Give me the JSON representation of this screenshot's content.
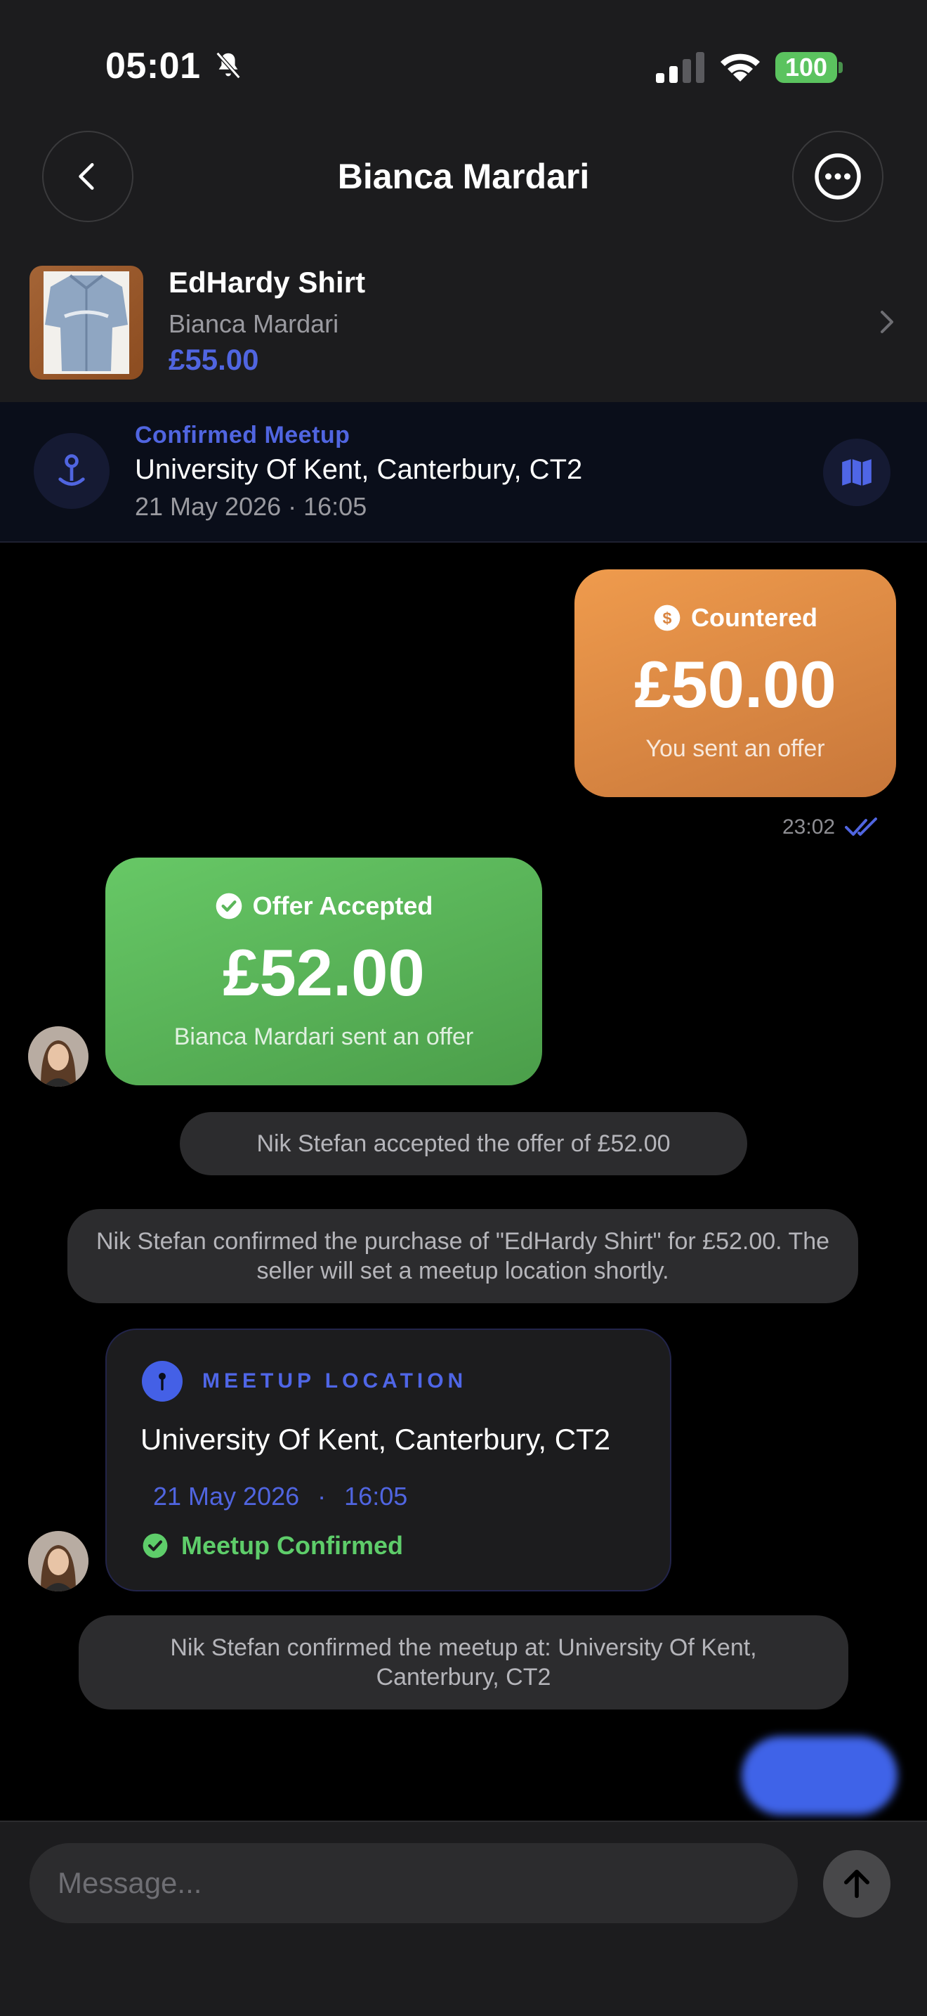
{
  "status_bar": {
    "time": "05:01",
    "battery": "100"
  },
  "header": {
    "title": "Bianca Mardari"
  },
  "listing": {
    "title": "EdHardy Shirt",
    "seller": "Bianca Mardari",
    "price": "£55.00"
  },
  "meetup_banner": {
    "label": "Confirmed Meetup",
    "place": "University Of Kent, Canterbury, CT2",
    "datetime": "21 May 2026 · 16:05"
  },
  "messages": {
    "countered": {
      "status": "Countered",
      "amount": "£50.00",
      "subtitle": "You sent an offer",
      "time": "23:02"
    },
    "accepted": {
      "status": "Offer Accepted",
      "amount": "£52.00",
      "subtitle": "Bianca Mardari sent an offer"
    },
    "system_1": "Nik Stefan accepted the offer of £52.00",
    "system_2": "Nik Stefan confirmed the purchase of \"EdHardy Shirt\" for £52.00. The seller will set a meetup location shortly.",
    "meetup_card": {
      "label": "MEETUP LOCATION",
      "place": "University Of Kent, Canterbury, CT2",
      "date": "21 May 2026",
      "separator": "·",
      "time": "16:05",
      "status": "Meetup Confirmed"
    },
    "system_3": "Nik Stefan confirmed the meetup at: University Of Kent, Canterbury, CT2"
  },
  "composer": {
    "placeholder": "Message..."
  },
  "colors": {
    "accent": "#5065e0",
    "countered": "#e48b44",
    "accepted": "#5bb65a",
    "confirmed": "#5ecd6a"
  },
  "icons": [
    "bell-slash-icon",
    "signal-icon",
    "wifi-icon",
    "battery-icon",
    "chevron-left-icon",
    "ellipsis-icon",
    "chevron-right-icon",
    "map-pin-icon",
    "map-icon",
    "currency-icon",
    "check-circle-icon",
    "double-check-icon",
    "arrow-up-icon"
  ]
}
